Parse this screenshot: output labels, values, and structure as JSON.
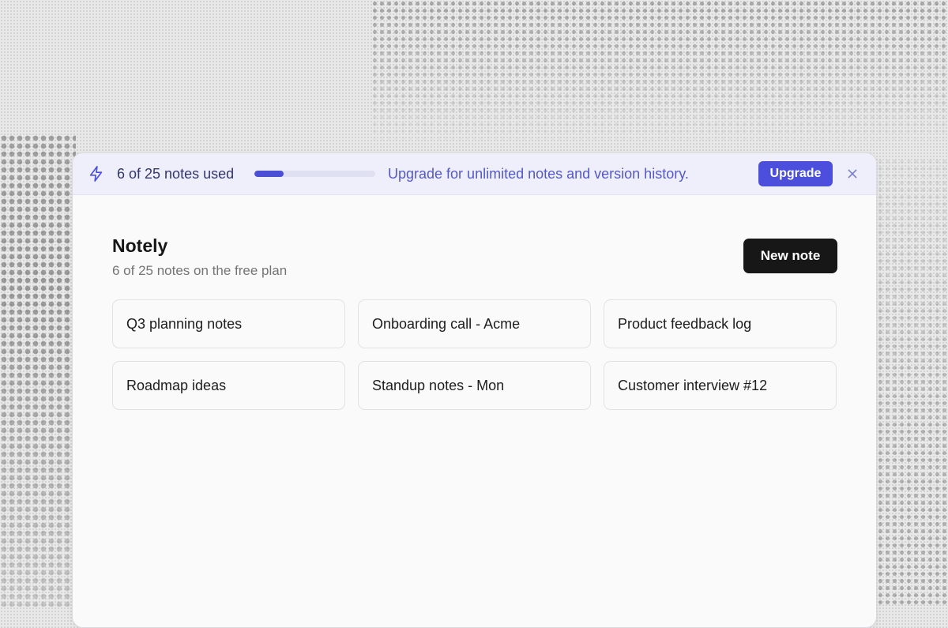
{
  "banner": {
    "icon": "bolt-icon",
    "usage_text": "6 of 25 notes used",
    "usage_used": 6,
    "usage_limit": 25,
    "message": "Upgrade for unlimited notes and version history.",
    "upgrade_label": "Upgrade",
    "close_icon": "close-icon"
  },
  "header": {
    "title": "Notely",
    "subtitle": "6 of 25 notes on the free plan",
    "new_note_label": "New note"
  },
  "notes": [
    {
      "title": "Q3 planning notes"
    },
    {
      "title": "Onboarding call - Acme"
    },
    {
      "title": "Product feedback log"
    },
    {
      "title": "Roadmap ideas"
    },
    {
      "title": "Standup notes - Mon"
    },
    {
      "title": "Customer interview #12"
    }
  ],
  "colors": {
    "accent": "#4b4fdb",
    "banner_bg": "#eeeffb",
    "primary_button": "#171717"
  }
}
